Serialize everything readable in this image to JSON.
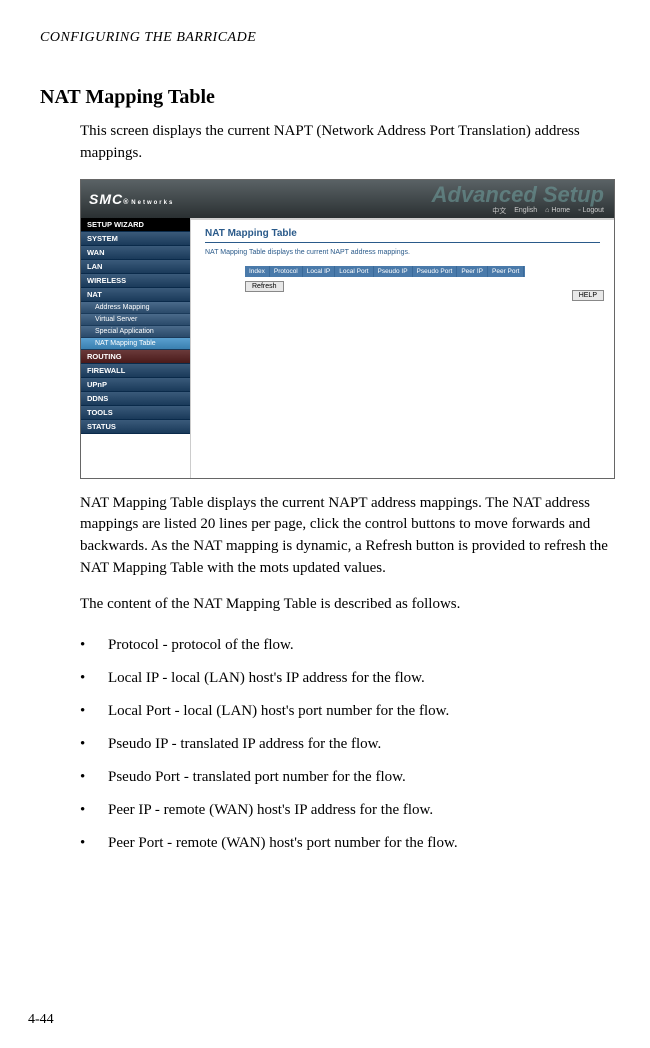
{
  "header": "CONFIGURING THE BARRICADE",
  "section_title": "NAT Mapping Table",
  "intro": "This screen displays the current NAPT (Network Address Port Translation) address mappings.",
  "screenshot": {
    "logo": "SMC",
    "logo_reg": "®",
    "logo_sub": "Networks",
    "advanced": "Advanced Setup",
    "links": {
      "lang1": "中文",
      "lang2": "English",
      "home": "Home",
      "logout": "Logout"
    },
    "nav": {
      "setup_wizard": "SETUP WIZARD",
      "system": "SYSTEM",
      "wan": "WAN",
      "lan": "LAN",
      "wireless": "WIRELESS",
      "nat": "NAT",
      "address_mapping": "Address Mapping",
      "virtual_server": "Virtual Server",
      "special_application": "Special Application",
      "nat_mapping_table": "NAT Mapping Table",
      "routing": "ROUTING",
      "firewall": "FIREWALL",
      "upnp": "UPnP",
      "ddns": "DDNS",
      "tools": "TOOLS",
      "status": "STATUS"
    },
    "panel": {
      "title": "NAT Mapping Table",
      "desc": "NAT Mapping Table displays the current NAPT address mappings.",
      "cols": {
        "index": "Index",
        "protocol": "Protocol",
        "local_ip": "Local IP",
        "local_port": "Local Port",
        "pseudo_ip": "Pseudo IP",
        "pseudo_port": "Pseudo Port",
        "peer_ip": "Peer IP",
        "peer_port": "Peer Port"
      },
      "refresh": "Refresh",
      "help": "HELP"
    }
  },
  "para2": "NAT Mapping Table displays the current NAPT address mappings. The NAT address mappings are listed 20 lines per page, click the control buttons to move forwards and backwards. As the NAT mapping is dynamic, a Refresh button is provided to refresh the NAT Mapping Table with the mots updated values.",
  "para3": "The content of the NAT Mapping Table is described as follows.",
  "bullets": [
    "Protocol - protocol of the flow.",
    "Local IP - local (LAN) host's IP address for the flow.",
    "Local Port - local (LAN) host's port number for the flow.",
    "Pseudo IP - translated IP address for the flow.",
    "Pseudo Port - translated port number for the flow.",
    "Peer IP - remote (WAN) host's IP address for the flow.",
    "Peer Port - remote (WAN) host's port number for the flow."
  ],
  "page_num": "4-44"
}
